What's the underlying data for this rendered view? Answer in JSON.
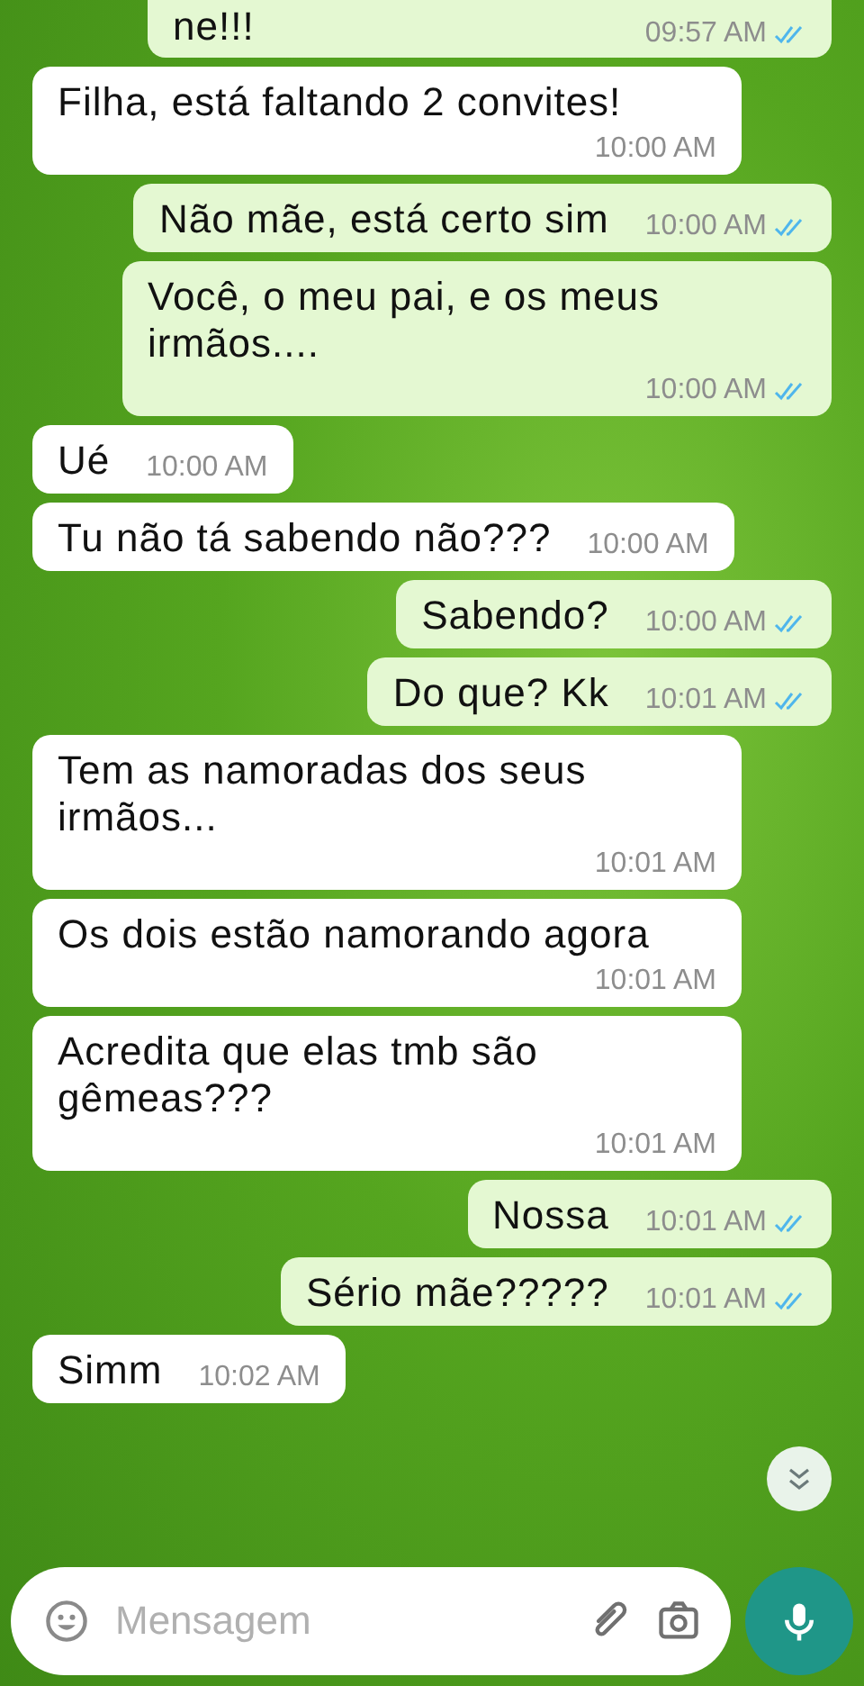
{
  "messages": [
    {
      "kind": "outgoing",
      "text": "ne!!!",
      "time": "09:57 AM",
      "read": true
    },
    {
      "kind": "incoming",
      "text": "Filha, está faltando 2 convites!",
      "time": "10:00 AM"
    },
    {
      "kind": "outgoing",
      "text": "Não mãe, está certo sim",
      "time": "10:00 AM",
      "read": true
    },
    {
      "kind": "outgoing",
      "text": "Você, o meu pai, e os meus irmãos....",
      "time": "10:00 AM",
      "read": true
    },
    {
      "kind": "incoming",
      "text": "Ué",
      "time": "10:00 AM"
    },
    {
      "kind": "incoming",
      "text": "Tu não tá sabendo não???",
      "time": "10:00 AM"
    },
    {
      "kind": "outgoing",
      "text": "Sabendo?",
      "time": "10:00 AM",
      "read": true
    },
    {
      "kind": "outgoing",
      "text": "Do que? Kk",
      "time": "10:01 AM",
      "read": true
    },
    {
      "kind": "incoming",
      "text": "Tem as namoradas dos seus irmãos...",
      "time": "10:01 AM"
    },
    {
      "kind": "incoming",
      "text": "Os dois estão namorando agora",
      "time": "10:01 AM"
    },
    {
      "kind": "incoming",
      "text": "Acredita que elas tmb são gêmeas???",
      "time": "10:01 AM"
    },
    {
      "kind": "outgoing",
      "text": "Nossa",
      "time": "10:01 AM",
      "read": true
    },
    {
      "kind": "outgoing",
      "text": "Sério mãe?????",
      "time": "10:01 AM",
      "read": true
    },
    {
      "kind": "incoming",
      "text": "Simm",
      "time": "10:02 AM"
    }
  ],
  "composer": {
    "placeholder": "Mensagem"
  }
}
